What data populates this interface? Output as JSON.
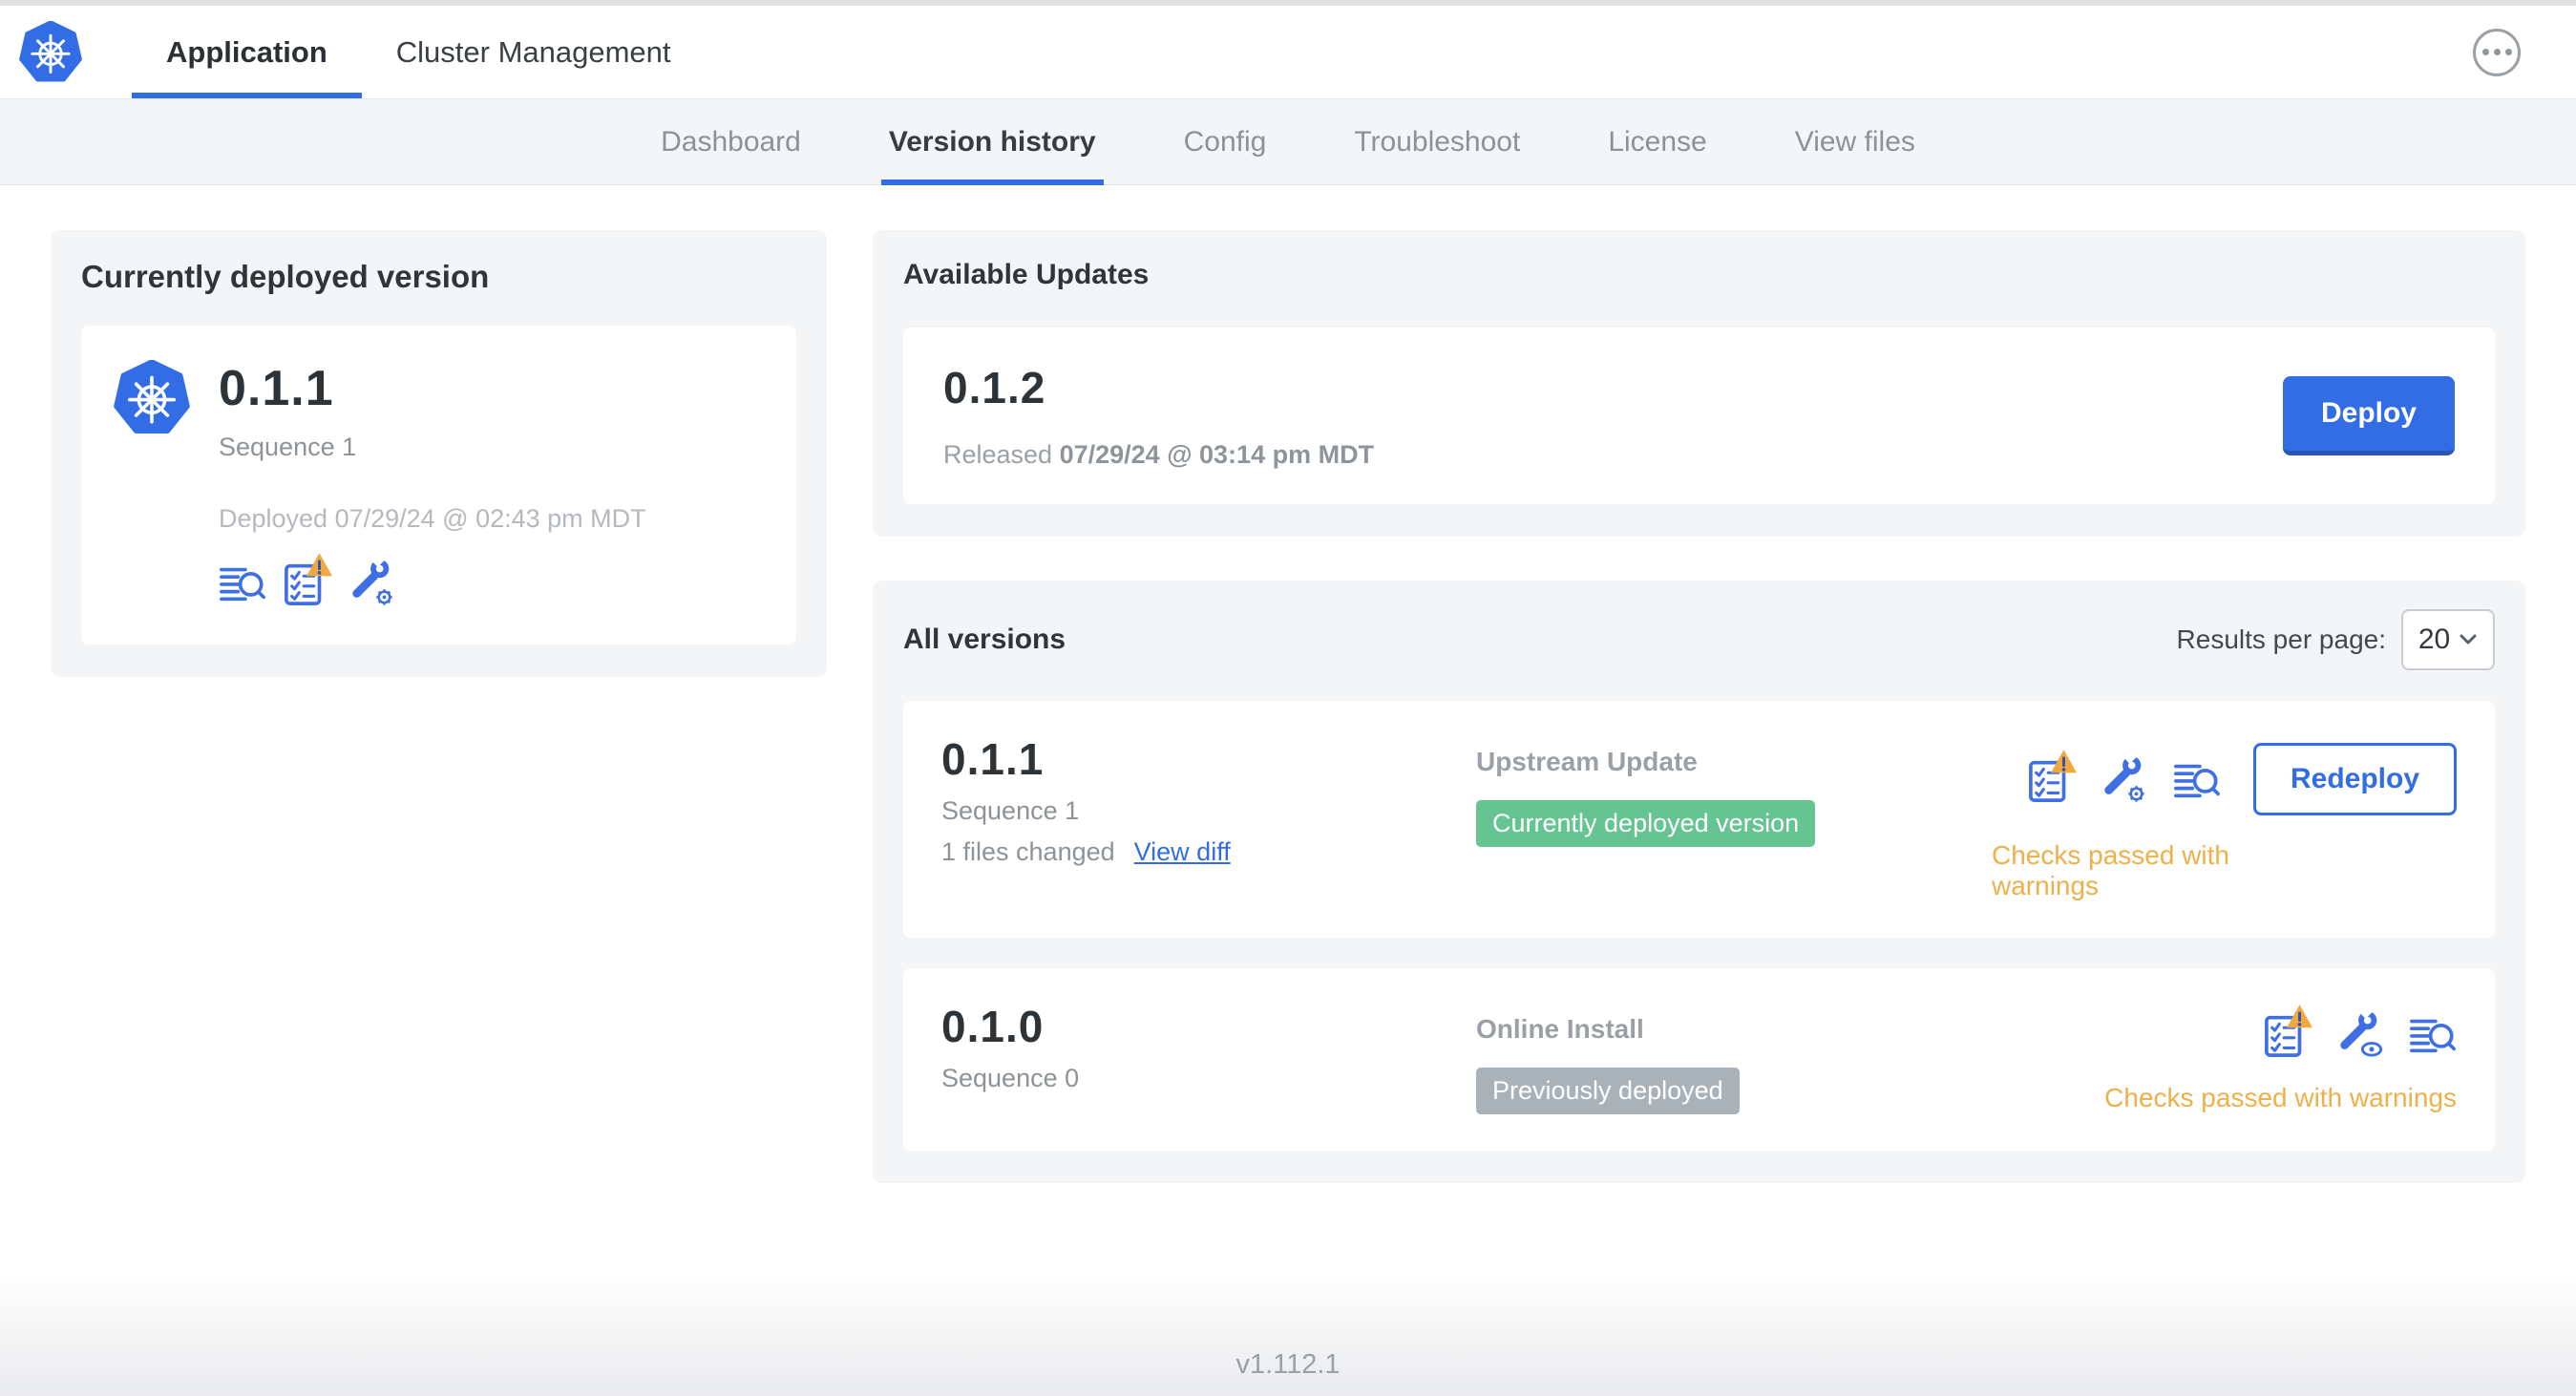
{
  "header": {
    "tabs": [
      {
        "label": "Application",
        "active": true
      },
      {
        "label": "Cluster Management",
        "active": false
      }
    ]
  },
  "subnav": {
    "tabs": [
      {
        "label": "Dashboard",
        "active": false
      },
      {
        "label": "Version history",
        "active": true
      },
      {
        "label": "Config",
        "active": false
      },
      {
        "label": "Troubleshoot",
        "active": false
      },
      {
        "label": "License",
        "active": false
      },
      {
        "label": "View files",
        "active": false
      }
    ]
  },
  "current_version": {
    "title": "Currently deployed version",
    "version": "0.1.1",
    "sequence": "Sequence 1",
    "deployed": "Deployed 07/29/24 @ 02:43 pm MDT"
  },
  "available_updates": {
    "title": "Available Updates",
    "version": "0.1.2",
    "released_prefix": "Released",
    "released_date": "07/29/24 @ 03:14 pm MDT",
    "deploy_label": "Deploy"
  },
  "all_versions": {
    "title": "All versions",
    "results_per_page_label": "Results per page:",
    "results_per_page_value": "20",
    "rows": [
      {
        "version": "0.1.1",
        "sequence": "Sequence 1",
        "files_changed": "1 files changed",
        "view_diff_label": "View diff",
        "source": "Upstream Update",
        "badge": "Currently deployed version",
        "checks_status": "Checks passed with warnings",
        "action_label": "Redeploy"
      },
      {
        "version": "0.1.0",
        "sequence": "Sequence 0",
        "source": "Online Install",
        "badge": "Previously deployed",
        "checks_status": "Checks passed with warnings"
      }
    ]
  },
  "footer": {
    "app_manager_version": "v1.112.1"
  },
  "icons": {
    "logo": "kubernetes-wheel-logo",
    "menu": "ellipsis-in-circle",
    "logs": "log-lines-magnifier",
    "preflight": "checklist-with-warning",
    "config_edit": "wrench-with-gear",
    "config_view": "wrench-with-eye",
    "select": "chevron-down"
  },
  "colors": {
    "accent_blue": "#326de6",
    "icon_blue": "#3f6fe4",
    "badge_green": "#65c491",
    "badge_gray": "#a9b2b9",
    "warning_text": "#edb04a",
    "warning_triangle": "#f2a93b"
  }
}
